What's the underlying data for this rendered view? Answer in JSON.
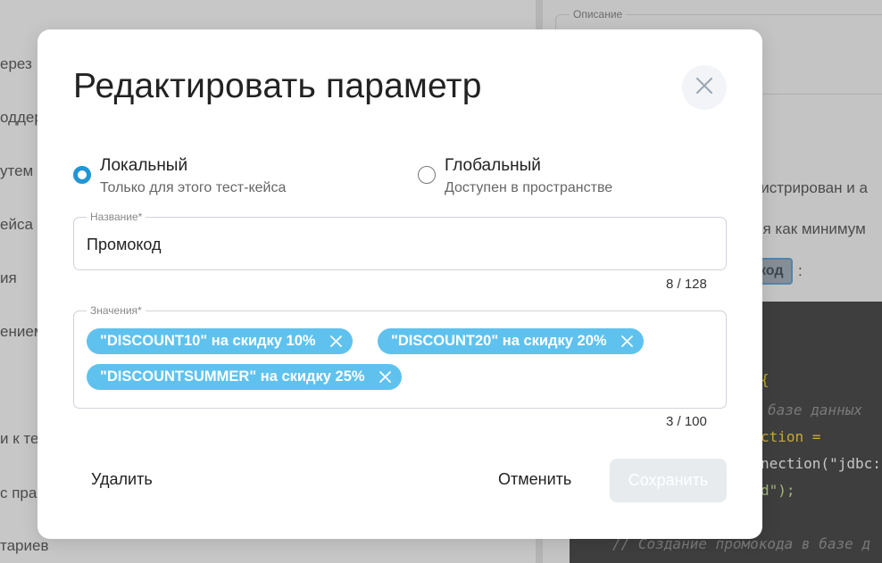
{
  "background": {
    "left_fragments": [
      "ерез",
      "оддер",
      "утем",
      "ейса ч",
      "ия",
      "ением",
      "и к те",
      "с пра",
      "тариев"
    ],
    "description_legend": "Описание",
    "right_fragments": [
      "гистрирован и а",
      "ся как минимум"
    ],
    "tag_chip": "код",
    "tag_colon": ":",
    "code": {
      "brace": "{",
      "comment1": "базе данных",
      "line_connection": "ction =",
      "line_get_connection": "nection(\"jdbc:",
      "line_close": "d\");",
      "comment2": "// Создание промокода в базе д"
    }
  },
  "modal": {
    "title": "Редактировать параметр",
    "close_icon": "close-icon",
    "scope_options": [
      {
        "label": "Локальный",
        "description": "Только для этого тест-кейса",
        "selected": true
      },
      {
        "label": "Глобальный",
        "description": "Доступен в пространстве",
        "selected": false
      }
    ],
    "name_field": {
      "label": "Название*",
      "value": "Промокод",
      "counter": "8 / 128"
    },
    "values_field": {
      "label": "Значения*",
      "chips": [
        "\"DISCOUNT10\" на скидку 10%",
        "\"DISCOUNT20\" на скидку 20%",
        "\"DISCOUNTSUMMER\" на скидку 25%"
      ],
      "counter": "3 / 100"
    },
    "buttons": {
      "delete": "Удалить",
      "cancel": "Отменить",
      "save": "Сохранить"
    },
    "colors": {
      "accent": "#2196d6",
      "chip": "#5fc2ee",
      "save_disabled": "#e7ebee"
    }
  }
}
